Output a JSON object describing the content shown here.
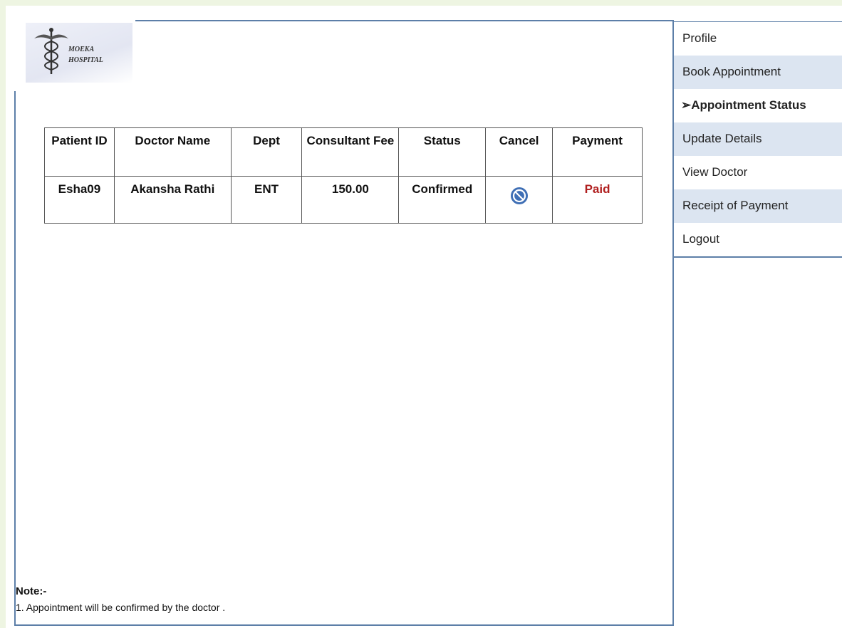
{
  "logo": {
    "line1": "MOEKA",
    "line2": "HOSPITAL"
  },
  "table": {
    "headers": {
      "patient_id": "Patient ID",
      "doctor_name": "Doctor Name",
      "dept": "Dept",
      "fee": "Consultant Fee",
      "status": "Status",
      "cancel": "Cancel",
      "payment": "Payment"
    },
    "rows": [
      {
        "patient_id": "Esha09",
        "doctor_name": "Akansha Rathi",
        "dept": "ENT",
        "fee": "150.00",
        "status": "Confirmed",
        "cancel_icon": "cancel-icon",
        "payment": "Paid"
      }
    ]
  },
  "note": {
    "title": "Note:-",
    "line1": "1. Appointment will be confirmed by the doctor ."
  },
  "sidebar": {
    "items": [
      {
        "label": "Profile"
      },
      {
        "label": "Book Appointment"
      },
      {
        "label": "➢Appointment Status"
      },
      {
        "label": "Update Details"
      },
      {
        "label": "View Doctor"
      },
      {
        "label": "Receipt of Payment"
      },
      {
        "label": "Logout"
      }
    ],
    "active_index": 2
  },
  "colors": {
    "page_bg": "#eef5e2",
    "border": "#5d7fa8",
    "sidebar_shade": "#dce5f1",
    "paid_text": "#b01f1f",
    "cancel_icon": "#3f6fb5"
  }
}
